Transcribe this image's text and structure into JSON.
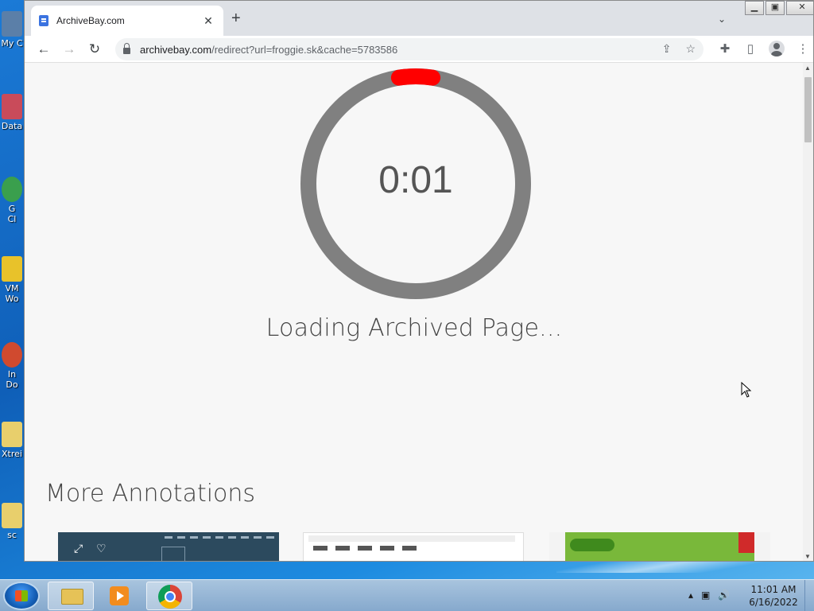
{
  "desktop": {
    "icons": [
      {
        "label": "My C"
      },
      {
        "label": "Data"
      },
      {
        "label": "G"
      },
      {
        "label": "Cl"
      },
      {
        "label": "VM"
      },
      {
        "label": "Wo"
      },
      {
        "label": "In"
      },
      {
        "label": "Do"
      },
      {
        "label": "Xtrei"
      },
      {
        "label": "sc"
      }
    ]
  },
  "browser": {
    "tab": {
      "title": "ArchiveBay.com",
      "close_glyph": "✕"
    },
    "new_tab_glyph": "+",
    "tab_list_glyph": "⌄",
    "window_controls": {
      "minimize": "▁",
      "maximize": "▣",
      "close": "✕"
    },
    "nav": {
      "back": "←",
      "forward": "→",
      "reload": "↻"
    },
    "address": {
      "host": "archivebay.com",
      "path": "/redirect?url=froggie.sk&cache=5783586"
    },
    "omnibox_icons": {
      "share": "⇪",
      "bookmark": "☆"
    },
    "toolbar_icons": {
      "extensions": "✚",
      "sidepanel": "▯",
      "menu": "⋮"
    }
  },
  "page": {
    "timer": "0:01",
    "timer_progress": 0.05,
    "loading_text": "Loading Archived Page...",
    "more_heading": "More Annotations",
    "card_icons": {
      "expand": "⤢",
      "favorite": "♡"
    }
  },
  "colors": {
    "ring": "#808080",
    "progress": "#ff0000"
  },
  "taskbar": {
    "clock_time": "11:01 AM",
    "clock_date": "6/16/2022",
    "tray_icons": {
      "chevron": "▴",
      "network": "▣",
      "volume": "🔊"
    }
  }
}
